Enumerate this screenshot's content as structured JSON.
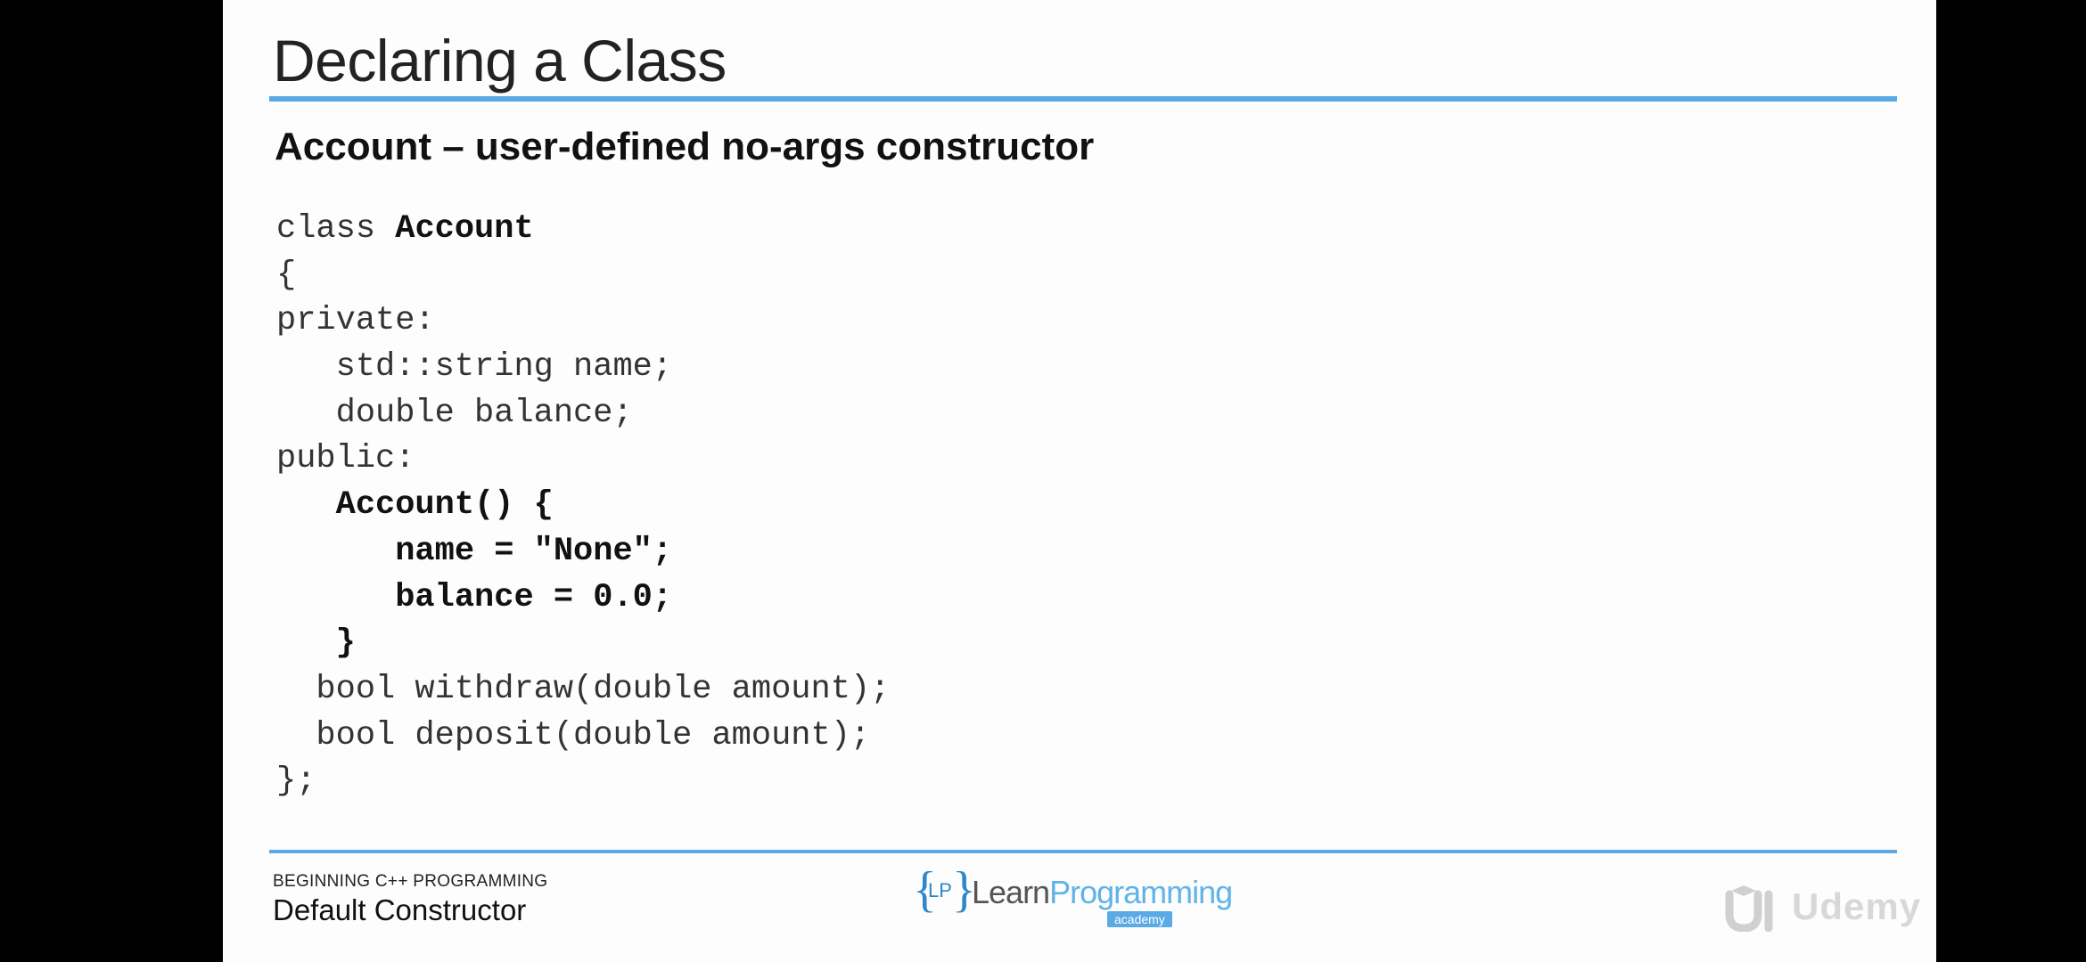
{
  "slide": {
    "title": "Declaring a Class",
    "subtitle": "Account – user-defined no-args constructor",
    "code": {
      "l1_kw": "class ",
      "l1_name": "Account",
      "l2": "{",
      "l3": "private:",
      "l4": "   std::string name;",
      "l5": "   double balance;",
      "l6": "public:",
      "l7": "   Account() {",
      "l8": "      name = \"None\";",
      "l9": "      balance = 0.0;",
      "l10": "   }",
      "l11": "  bool withdraw(double amount);",
      "l12": "  bool deposit(double amount);",
      "l13": "};"
    },
    "footer": {
      "course": "BEGINNING C++ PROGRAMMING",
      "topic": "Default Constructor"
    },
    "logo": {
      "brace_left": "{",
      "initials": "LP",
      "brace_right": "}",
      "word_part1": "Learn",
      "word_part2": "Programming",
      "badge": "academy"
    },
    "watermark": {
      "text": "Udemy",
      "icon": "udemy-logo-icon"
    },
    "colors": {
      "accent": "#5aaae6",
      "background": "#fdfdfd",
      "frame": "#000000"
    }
  }
}
